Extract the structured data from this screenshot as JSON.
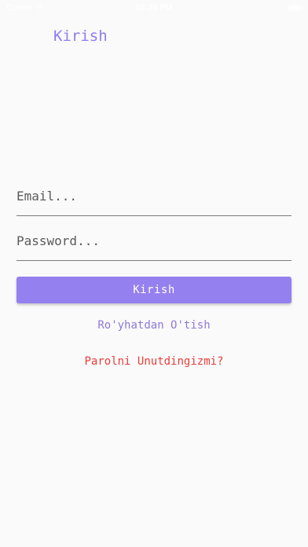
{
  "status_bar": {
    "carrier": "Carrier",
    "time": "10:29 PM",
    "wifi_icon": "wifi-icon",
    "battery_icon": "battery-icon"
  },
  "header": {
    "title": "Kirish"
  },
  "form": {
    "email_placeholder": "Email...",
    "email_value": "",
    "password_placeholder": "Password...",
    "password_value": "",
    "submit_label": "Kirish"
  },
  "links": {
    "register": "Ro'yhatdan O'tish",
    "forgot_password": "Parolni Unutdingizmi?"
  },
  "colors": {
    "accent": "#9580ef",
    "title": "#8e7cf0",
    "link": "#8c7ad8",
    "danger": "#e8403a",
    "background": "#fafafa"
  }
}
